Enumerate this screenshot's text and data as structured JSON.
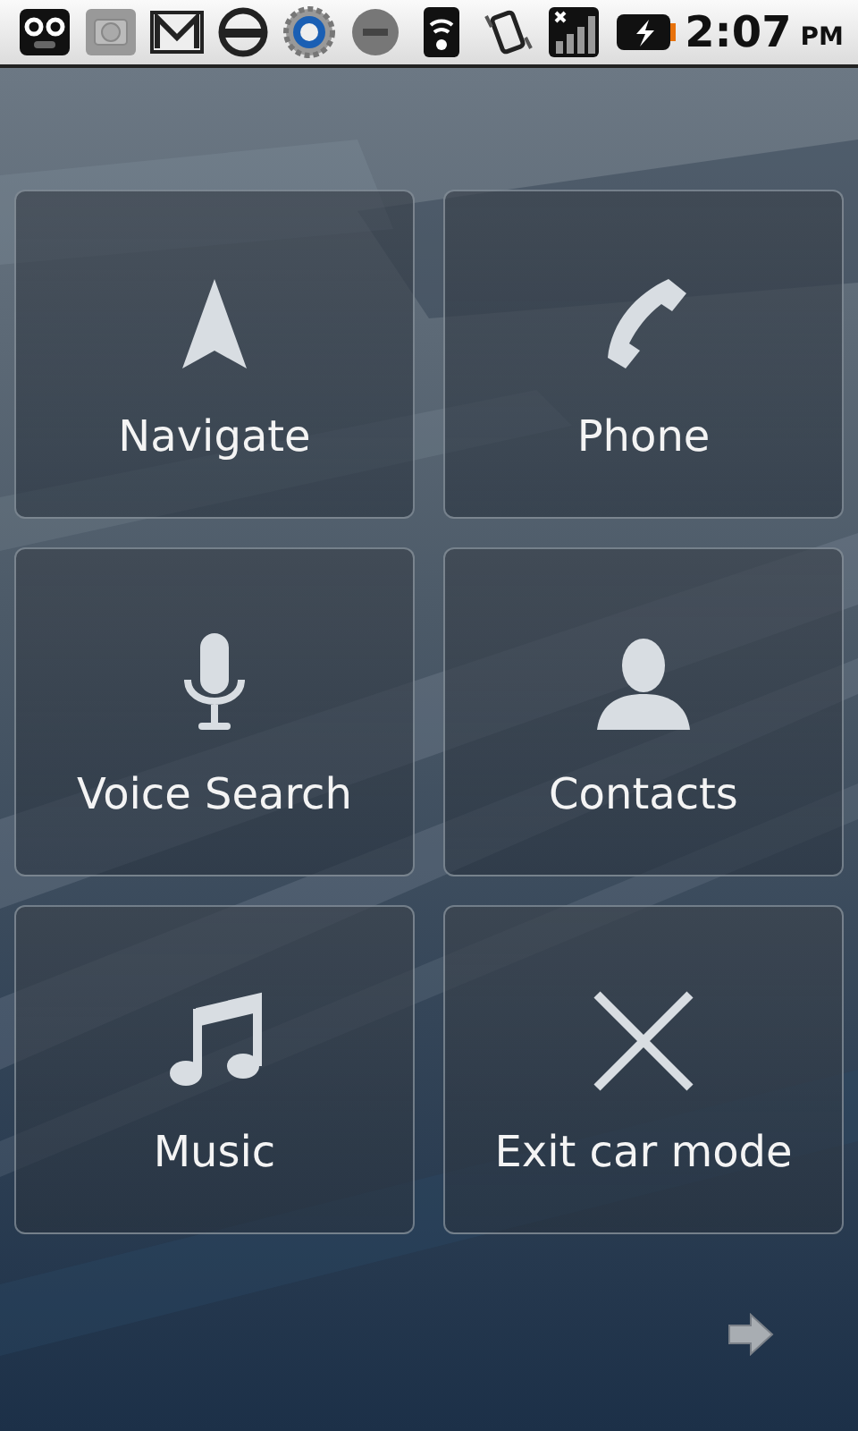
{
  "status_bar": {
    "time": "2:07",
    "period": "PM"
  },
  "tiles": [
    {
      "kind": "navigate",
      "label": "Navigate"
    },
    {
      "kind": "phone",
      "label": "Phone"
    },
    {
      "kind": "voice",
      "label": "Voice Search"
    },
    {
      "kind": "contacts",
      "label": "Contacts"
    },
    {
      "kind": "music",
      "label": "Music"
    },
    {
      "kind": "exit",
      "label": "Exit car mode"
    }
  ]
}
